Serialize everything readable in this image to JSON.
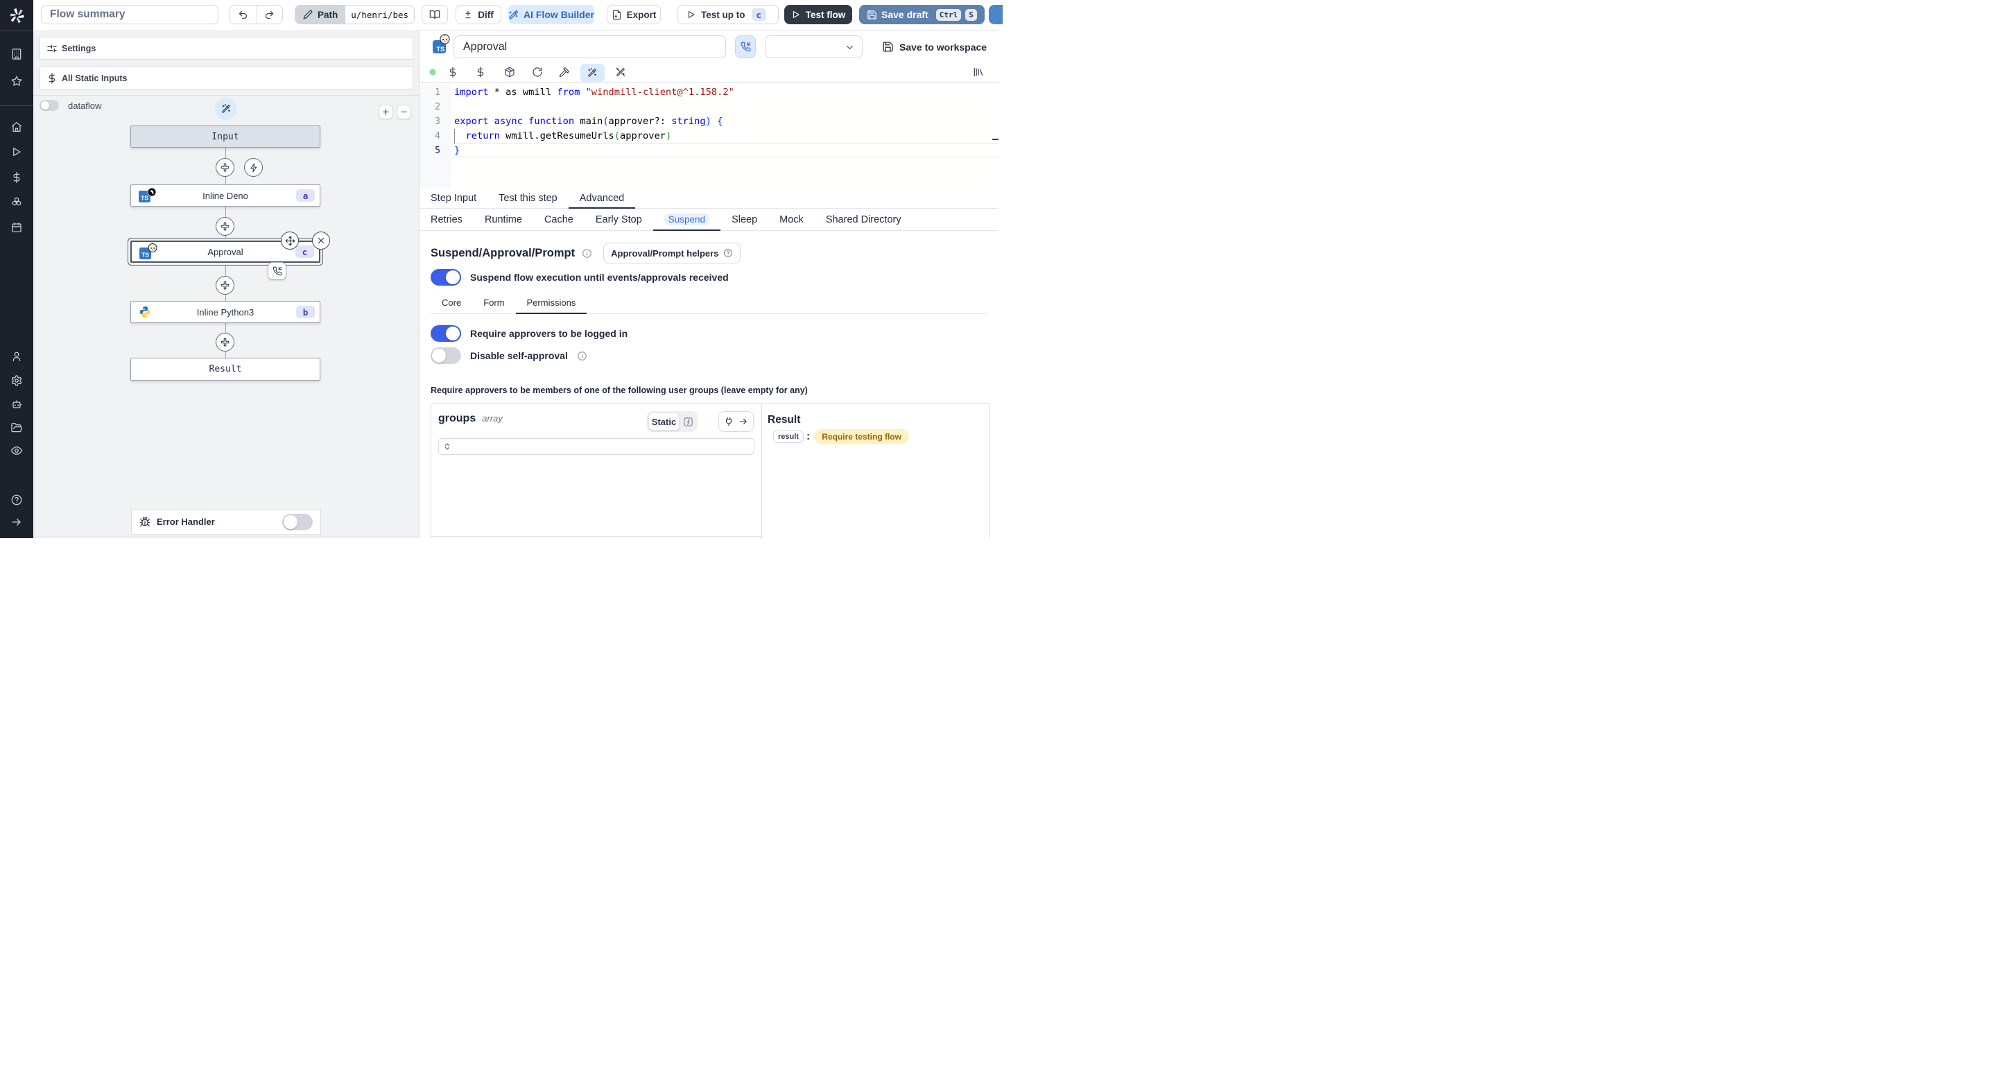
{
  "colors": {
    "sidebar_bg": "#1c212c",
    "accent_blue": "#3b5fe9",
    "save_draft_bg": "#5e81ac",
    "test_flow_bg": "#313845",
    "ai_builder_bg": "#dbeafe",
    "ai_builder_text": "#2f66c8",
    "badge_bg": "#dfe4fb",
    "badge_text": "#423dab",
    "yellow_badge_bg": "#fdf2c4",
    "yellow_badge_text": "#95630d"
  },
  "sidebar": {
    "logo": "windmill-logo",
    "items": [
      {
        "icon": "building-icon",
        "name": "workspace"
      },
      {
        "icon": "star-icon",
        "name": "favorites"
      },
      {
        "icon": "home-icon",
        "name": "home"
      },
      {
        "icon": "play-icon",
        "name": "runs"
      },
      {
        "icon": "dollar-icon",
        "name": "variables"
      },
      {
        "icon": "boxes-icon",
        "name": "resources"
      },
      {
        "icon": "calendar-icon",
        "name": "schedules"
      },
      {
        "icon": "user-icon",
        "name": "users"
      },
      {
        "icon": "gear-icon",
        "name": "settings"
      },
      {
        "icon": "bot-icon",
        "name": "workers"
      },
      {
        "icon": "folder-icon",
        "name": "folders"
      },
      {
        "icon": "eye-icon",
        "name": "audit-logs"
      },
      {
        "icon": "help-icon",
        "name": "help"
      },
      {
        "icon": "arrow-right-icon",
        "name": "expand"
      }
    ]
  },
  "topbar": {
    "flow_summary": "Flow summary",
    "path_label": "Path",
    "path_value": "u/henri/bes",
    "diff_label": "Diff",
    "ai_flow_builder_label": "AI Flow Builder",
    "export_label": "Export",
    "test_up_to_label": "Test up to",
    "test_up_to_badge": "c",
    "test_flow_label": "Test flow",
    "save_draft_label": "Save draft",
    "kbd_ctrl": "Ctrl",
    "kbd_s": "S"
  },
  "left_panel": {
    "settings_label": "Settings",
    "all_static_inputs_label": "All Static Inputs",
    "dataflow_label": "dataflow",
    "error_handler_label": "Error Handler",
    "nodes": {
      "input": {
        "label": "Input"
      },
      "deno": {
        "label": "Inline Deno",
        "badge": "a"
      },
      "approval": {
        "label": "Approval",
        "badge": "c"
      },
      "python": {
        "label": "Inline Python3",
        "badge": "b"
      },
      "result": {
        "label": "Result"
      }
    }
  },
  "step_header": {
    "name_value": "Approval",
    "save_to_workspace_label": "Save to workspace"
  },
  "editor": {
    "language_badge": "TS",
    "lines": [
      {
        "n": "1",
        "toks": [
          [
            "import",
            "kw"
          ],
          [
            " * as wmill ",
            "tx"
          ],
          [
            "from",
            "kw"
          ],
          [
            " ",
            "tx"
          ],
          [
            "\"windmill-client@^1.158.2\"",
            "str"
          ]
        ]
      },
      {
        "n": "2",
        "toks": []
      },
      {
        "n": "3",
        "toks": [
          [
            "export",
            "kw"
          ],
          [
            " ",
            "tx"
          ],
          [
            "async",
            "kw"
          ],
          [
            " ",
            "tx"
          ],
          [
            "function",
            "kw"
          ],
          [
            " main",
            "tx"
          ],
          [
            "(",
            "b1"
          ],
          [
            "approver?: ",
            "tx"
          ],
          [
            "string",
            "kw"
          ],
          [
            ")",
            "b1"
          ],
          [
            " ",
            "tx"
          ],
          [
            "{",
            "b1"
          ]
        ]
      },
      {
        "n": "4",
        "toks": [
          [
            "  ",
            "tx"
          ],
          [
            "return",
            "kw"
          ],
          [
            " wmill.getResumeUrls",
            "tx"
          ],
          [
            "(",
            "b2"
          ],
          [
            "approver",
            "tx"
          ],
          [
            ")",
            "b2"
          ]
        ]
      },
      {
        "n": "5",
        "toks": [
          [
            "}",
            "b1"
          ]
        ],
        "active": true
      }
    ]
  },
  "step_tabs": [
    {
      "label": "Step Input",
      "active": false
    },
    {
      "label": "Test this step",
      "active": false
    },
    {
      "label": "Advanced",
      "active": true
    }
  ],
  "advanced_tabs": [
    {
      "label": "Retries",
      "active": false
    },
    {
      "label": "Runtime",
      "active": false
    },
    {
      "label": "Cache",
      "active": false
    },
    {
      "label": "Early Stop",
      "active": false
    },
    {
      "label": "Suspend",
      "active": true
    },
    {
      "label": "Sleep",
      "active": false
    },
    {
      "label": "Mock",
      "active": false
    },
    {
      "label": "Shared Directory",
      "active": false
    }
  ],
  "suspend_section": {
    "title": "Suspend/Approval/Prompt",
    "helpers_button_label": "Approval/Prompt helpers",
    "suspend_toggle_label": "Suspend flow execution until events/approvals received",
    "sub_tabs": [
      {
        "label": "Core",
        "active": false
      },
      {
        "label": "Form",
        "active": false
      },
      {
        "label": "Permissions",
        "active": true
      }
    ],
    "require_login_label": "Require approvers to be logged in",
    "disable_self_approval_label": "Disable self-approval",
    "groups_heading": "Require approvers to be members of one of the following user groups (leave empty for any)"
  },
  "groups_editor": {
    "field_name": "groups",
    "field_type": "array",
    "static_label": "Static",
    "input_value": ""
  },
  "result_panel": {
    "title": "Result",
    "key": "result",
    "separator": ":",
    "value": "Require testing flow"
  }
}
